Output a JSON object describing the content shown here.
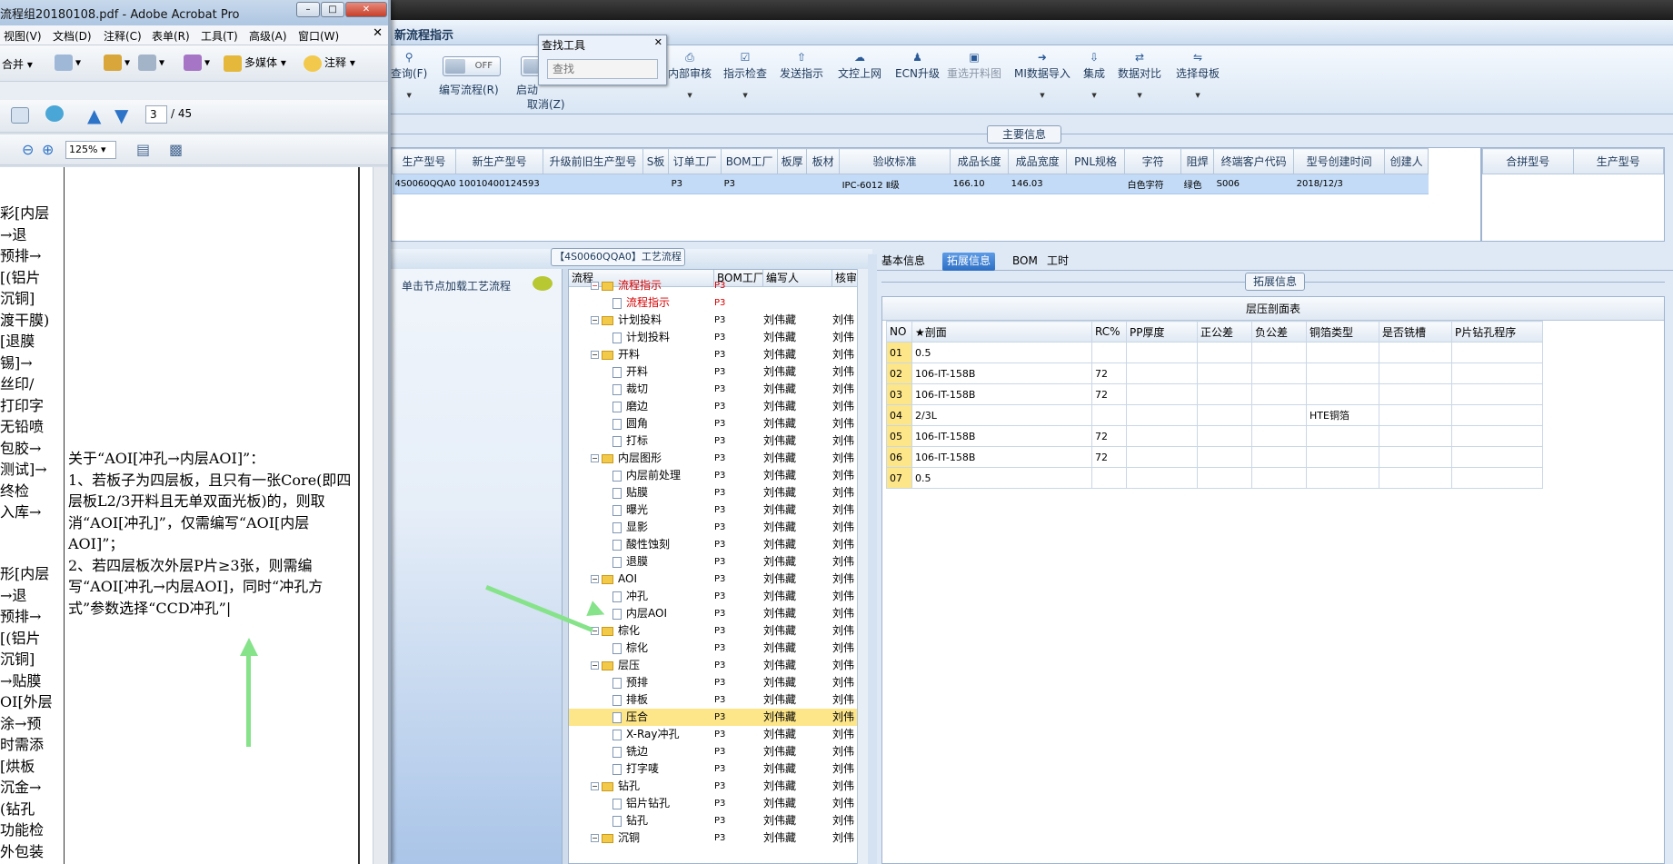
{
  "app": {
    "title": "新流程指示",
    "ribbon": {
      "query": "查询(F)",
      "toggle_off": "OFF",
      "write_process": "编写流程(R)",
      "start": "启动",
      "cancel": "取消(Z)",
      "buttons": [
        "内部审核",
        "指示检查",
        "发送指示",
        "文控上网",
        "ECN升级",
        "重选开料图",
        "MI数据导入",
        "集成",
        "数据对比",
        "选择母板"
      ]
    },
    "find_tool": {
      "title": "查找工具",
      "placeholder": "查找"
    },
    "main_info": {
      "label": "主要信息",
      "columns": [
        "生产型号",
        "新生产型号",
        "升级前旧生产型号",
        "S板",
        "订单工厂",
        "BOM工厂",
        "板厚",
        "板材",
        "验收标准",
        "成品长度",
        "成品宽度",
        "PNL规格",
        "字符",
        "阻焊",
        "终端客户代码",
        "型号创建时间",
        "创建人"
      ],
      "row": [
        "4S0060QQA0",
        "10010400124593",
        "",
        "",
        "P3",
        "P3",
        "",
        "",
        "IPC-6012 Ⅱ级",
        "166.10",
        "146.03",
        "",
        "白色字符",
        "绿色",
        "S006",
        "2018/12/3",
        ""
      ],
      "side_columns": [
        "合拼型号",
        "生产型号"
      ]
    },
    "process": {
      "label": "【4S0060QQA0】工艺流程",
      "click_load": "单击节点加载工艺流程",
      "columns": [
        "流程",
        "BOM工厂",
        "编写人",
        "核审"
      ],
      "rows": [
        {
          "level": 0,
          "folder": true,
          "name": "流程指示",
          "bom": "P3",
          "author": "",
          "check": "",
          "red": true
        },
        {
          "level": 1,
          "folder": false,
          "name": "流程指示",
          "bom": "P3",
          "author": "",
          "check": "",
          "red": true
        },
        {
          "level": 0,
          "folder": true,
          "name": "计划投料",
          "bom": "P3",
          "author": "刘伟藏",
          "check": "刘伟"
        },
        {
          "level": 1,
          "folder": false,
          "name": "计划投料",
          "bom": "P3",
          "author": "刘伟藏",
          "check": "刘伟"
        },
        {
          "level": 0,
          "folder": true,
          "name": "开料",
          "bom": "P3",
          "author": "刘伟藏",
          "check": "刘伟"
        },
        {
          "level": 1,
          "folder": false,
          "name": "开料",
          "bom": "P3",
          "author": "刘伟藏",
          "check": "刘伟"
        },
        {
          "level": 1,
          "folder": false,
          "name": "裁切",
          "bom": "P3",
          "author": "刘伟藏",
          "check": "刘伟"
        },
        {
          "level": 1,
          "folder": false,
          "name": "磨边",
          "bom": "P3",
          "author": "刘伟藏",
          "check": "刘伟"
        },
        {
          "level": 1,
          "folder": false,
          "name": "圆角",
          "bom": "P3",
          "author": "刘伟藏",
          "check": "刘伟"
        },
        {
          "level": 1,
          "folder": false,
          "name": "打标",
          "bom": "P3",
          "author": "刘伟藏",
          "check": "刘伟"
        },
        {
          "level": 0,
          "folder": true,
          "name": "内层图形",
          "bom": "P3",
          "author": "刘伟藏",
          "check": "刘伟"
        },
        {
          "level": 1,
          "folder": false,
          "name": "内层前处理",
          "bom": "P3",
          "author": "刘伟藏",
          "check": "刘伟"
        },
        {
          "level": 1,
          "folder": false,
          "name": "贴膜",
          "bom": "P3",
          "author": "刘伟藏",
          "check": "刘伟"
        },
        {
          "level": 1,
          "folder": false,
          "name": "曝光",
          "bom": "P3",
          "author": "刘伟藏",
          "check": "刘伟"
        },
        {
          "level": 1,
          "folder": false,
          "name": "显影",
          "bom": "P3",
          "author": "刘伟藏",
          "check": "刘伟"
        },
        {
          "level": 1,
          "folder": false,
          "name": "酸性蚀刻",
          "bom": "P3",
          "author": "刘伟藏",
          "check": "刘伟"
        },
        {
          "level": 1,
          "folder": false,
          "name": "退膜",
          "bom": "P3",
          "author": "刘伟藏",
          "check": "刘伟"
        },
        {
          "level": 0,
          "folder": true,
          "name": "AOI",
          "bom": "P3",
          "author": "刘伟藏",
          "check": "刘伟"
        },
        {
          "level": 1,
          "folder": false,
          "name": "冲孔",
          "bom": "P3",
          "author": "刘伟藏",
          "check": "刘伟"
        },
        {
          "level": 1,
          "folder": false,
          "name": "内层AOI",
          "bom": "P3",
          "author": "刘伟藏",
          "check": "刘伟"
        },
        {
          "level": 0,
          "folder": true,
          "name": "棕化",
          "bom": "P3",
          "author": "刘伟藏",
          "check": "刘伟"
        },
        {
          "level": 1,
          "folder": false,
          "name": "棕化",
          "bom": "P3",
          "author": "刘伟藏",
          "check": "刘伟"
        },
        {
          "level": 0,
          "folder": true,
          "name": "层压",
          "bom": "P3",
          "author": "刘伟藏",
          "check": "刘伟"
        },
        {
          "level": 1,
          "folder": false,
          "name": "预排",
          "bom": "P3",
          "author": "刘伟藏",
          "check": "刘伟"
        },
        {
          "level": 1,
          "folder": false,
          "name": "排板",
          "bom": "P3",
          "author": "刘伟藏",
          "check": "刘伟"
        },
        {
          "level": 1,
          "folder": false,
          "name": "压合",
          "bom": "P3",
          "author": "刘伟藏",
          "check": "刘伟",
          "selected": true
        },
        {
          "level": 1,
          "folder": false,
          "name": "X-Ray冲孔",
          "bom": "P3",
          "author": "刘伟藏",
          "check": "刘伟"
        },
        {
          "level": 1,
          "folder": false,
          "name": "铣边",
          "bom": "P3",
          "author": "刘伟藏",
          "check": "刘伟"
        },
        {
          "level": 1,
          "folder": false,
          "name": "打字唛",
          "bom": "P3",
          "author": "刘伟藏",
          "check": "刘伟"
        },
        {
          "level": 0,
          "folder": true,
          "name": "钻孔",
          "bom": "P3",
          "author": "刘伟藏",
          "check": "刘伟"
        },
        {
          "level": 1,
          "folder": false,
          "name": "铝片钻孔",
          "bom": "P3",
          "author": "刘伟藏",
          "check": "刘伟"
        },
        {
          "level": 1,
          "folder": false,
          "name": "钻孔",
          "bom": "P3",
          "author": "刘伟藏",
          "check": "刘伟"
        },
        {
          "level": 0,
          "folder": true,
          "name": "沉铜",
          "bom": "P3",
          "author": "刘伟藏",
          "check": "刘伟"
        }
      ]
    },
    "tabs": [
      "基本信息",
      "拓展信息",
      "BOM",
      "工时"
    ],
    "ext": {
      "label": "拓展信息",
      "table_title": "层压剖面表",
      "columns": [
        "NO",
        "★剖面",
        "RC%",
        "PP厚度",
        "正公差",
        "负公差",
        "铜箔类型",
        "是否铣槽",
        "P片钻孔程序"
      ],
      "rows": [
        [
          "01",
          "0.5",
          "",
          "",
          "",
          "",
          "",
          "",
          ""
        ],
        [
          "02",
          "106-IT-158B",
          "72",
          "",
          "",
          "",
          "",
          "",
          ""
        ],
        [
          "03",
          "106-IT-158B",
          "72",
          "",
          "",
          "",
          "",
          "",
          ""
        ],
        [
          "04",
          "2/3L",
          "",
          "",
          "",
          "",
          "HTE铜箔",
          "",
          ""
        ],
        [
          "05",
          "106-IT-158B",
          "72",
          "",
          "",
          "",
          "",
          "",
          ""
        ],
        [
          "06",
          "106-IT-158B",
          "72",
          "",
          "",
          "",
          "",
          "",
          ""
        ],
        [
          "07",
          "0.5",
          "",
          "",
          "",
          "",
          "",
          "",
          ""
        ]
      ]
    }
  },
  "acrobat": {
    "title": "流程组20180108.pdf - Adobe Acrobat Pro",
    "menu": [
      "视图(V)",
      "文档(D)",
      "注释(C)",
      "表单(R)",
      "工具(T)",
      "高级(A)",
      "窗口(W)"
    ],
    "toolbar1": {
      "merge": "合并",
      "multimedia": "多媒体",
      "comment": "注释"
    },
    "page": {
      "current": "3",
      "total": "/ 45"
    },
    "zoom": "125%",
    "left_text_top": [
      "彩[内层",
      "→退",
      "预排→",
      "[(铝片",
      "沉铜]",
      "渡干膜)",
      "[退膜",
      "锡]→",
      "丝印/",
      "打印字",
      "无铅喷",
      "包胶→",
      "测试]→",
      "终检",
      "入库→"
    ],
    "left_text_bottom": [
      "形[内层",
      "→退",
      "预排→",
      "[(铝片",
      "沉铜]",
      "→贴膜",
      "OI[外层",
      "涂→预",
      "时需添",
      "[烘板",
      "沉金→",
      "(钻孔",
      "功能检",
      "外包装"
    ],
    "note": "关于“AOI[冲孔→内层AOI]”：\n1、若板子为四层板，且只有一张Core(即四层板L2/3开料且无单双面光板)的，则取消“AOI[冲孔]”，仅需编写“AOI[内层AOI]”；\n2、若四层板次外层P片≥3张，则需编写“AOI[冲孔→内层AOI]，同时“冲孔方式”参数选择“CCD冲孔”|"
  }
}
